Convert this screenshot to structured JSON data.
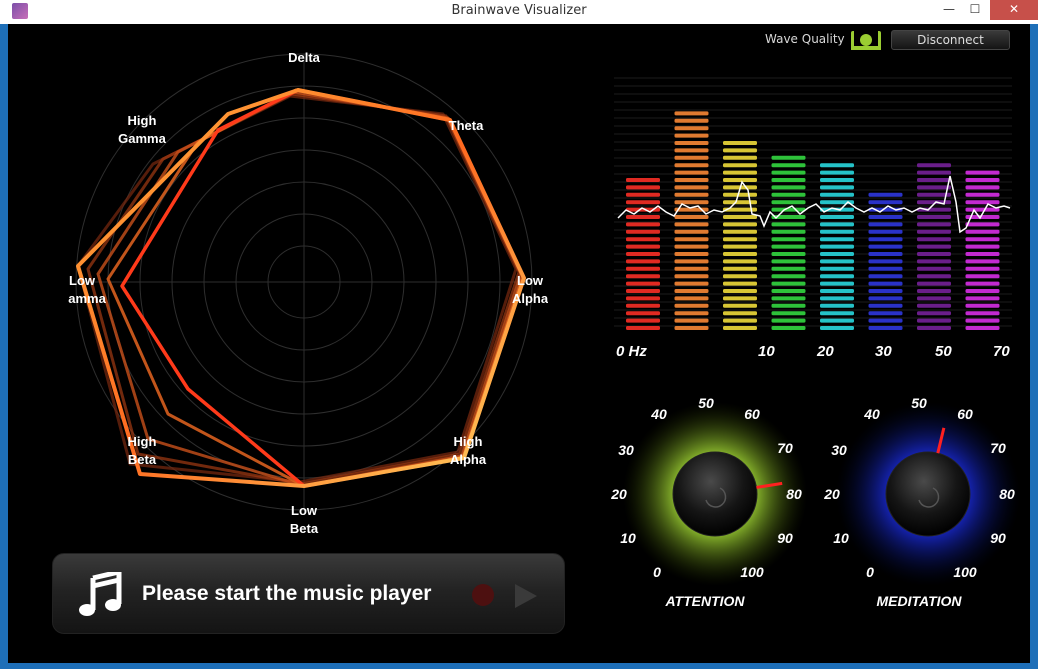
{
  "window": {
    "title": "Brainwave Visualizer",
    "min_glyph": "—",
    "max_glyph": "☐",
    "close_glyph": "✕"
  },
  "header": {
    "wave_quality_label": "Wave Quality",
    "disconnect_label": "Disconnect"
  },
  "radar": {
    "labels": {
      "delta": "Delta",
      "theta": "Theta",
      "low_alpha_1": "Low",
      "low_alpha_2": "Alpha",
      "high_alpha_1": "High",
      "high_alpha_2": "Alpha",
      "low_beta_1": "Low",
      "low_beta_2": "Beta",
      "high_beta_1": "High",
      "high_beta_2": "Beta",
      "low_gamma_1": "Low",
      "low_gamma_2": "Gamma",
      "high_gamma_1": "High",
      "high_gamma_2": "Gamma"
    }
  },
  "spectrum": {
    "freq_labels": [
      "0 Hz",
      "10",
      "20",
      "30",
      "50",
      "70"
    ],
    "bars": [
      {
        "color": "#e02a22",
        "level": 0.68
      },
      {
        "color": "#e07a30",
        "level": 0.96
      },
      {
        "color": "#d7c534",
        "level": 0.83
      },
      {
        "color": "#2ec23a",
        "level": 0.78
      },
      {
        "color": "#25c2c8",
        "level": 0.74
      },
      {
        "color": "#2a32c8",
        "level": 0.61
      },
      {
        "color": "#6a1e8a",
        "level": 0.74
      },
      {
        "color": "#c22ad0",
        "level": 0.7
      }
    ]
  },
  "attention": {
    "title": "ATTENTION",
    "value": 80,
    "glow": "#9acd32",
    "ticks": [
      "0",
      "10",
      "20",
      "30",
      "40",
      "50",
      "60",
      "70",
      "80",
      "90",
      "100"
    ]
  },
  "meditation": {
    "title": "MEDITATION",
    "value": 55,
    "glow": "#1a2bd8",
    "ticks": [
      "0",
      "10",
      "20",
      "30",
      "40",
      "50",
      "60",
      "70",
      "80",
      "90",
      "100"
    ]
  },
  "player": {
    "message": "Please start the music player"
  }
}
